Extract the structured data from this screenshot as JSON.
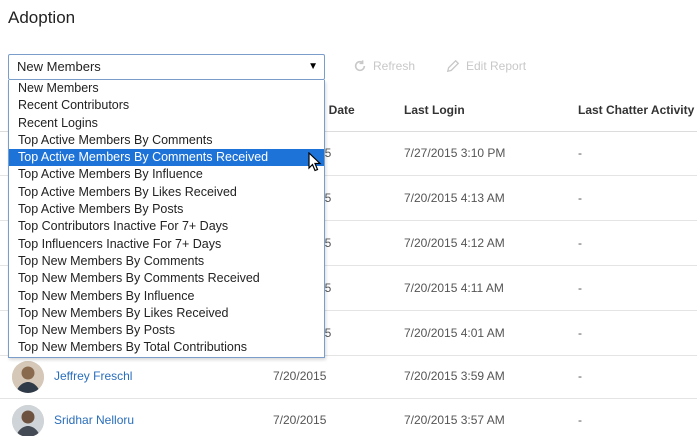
{
  "page": {
    "title": "Adoption"
  },
  "toolbar": {
    "selected_report": "New Members",
    "refresh_label": "Refresh",
    "edit_report_label": "Edit Report"
  },
  "dropdown": {
    "options": [
      "New Members",
      "Recent Contributors",
      "Recent Logins",
      "Top Active Members By Comments",
      "Top Active Members By Comments Received",
      "Top Active Members By Influence",
      "Top Active Members By Likes Received",
      "Top Active Members By Posts",
      "Top Contributors Inactive For 7+ Days",
      "Top Influencers Inactive For 7+ Days",
      "Top New Members By Comments",
      "Top New Members By Comments Received",
      "Top New Members By Influence",
      "Top New Members By Likes Received",
      "Top New Members By Posts",
      "Top New Members By Total Contributions"
    ],
    "highlighted_index": 4
  },
  "table": {
    "headers": {
      "created_date": "d Date",
      "last_login": "Last Login",
      "last_chatter_activity": "Last Chatter Activity"
    },
    "rows": [
      {
        "name": "",
        "created": "15",
        "last_login": "7/27/2015 3:10 PM",
        "last_activity": "-"
      },
      {
        "name": "",
        "created": "15",
        "last_login": "7/20/2015 4:13 AM",
        "last_activity": "-"
      },
      {
        "name": "",
        "created": "15",
        "last_login": "7/20/2015 4:12 AM",
        "last_activity": "-"
      },
      {
        "name": "",
        "created": "15",
        "last_login": "7/20/2015 4:11 AM",
        "last_activity": "-"
      },
      {
        "name": "",
        "created": "15",
        "last_login": "7/20/2015 4:01 AM",
        "last_activity": "-"
      },
      {
        "name": "Jeffrey Freschl",
        "created": "7/20/2015",
        "last_login": "7/20/2015 3:59 AM",
        "last_activity": "-"
      },
      {
        "name": "Sridhar Nelloru",
        "created": "7/20/2015",
        "last_login": "7/20/2015 3:57 AM",
        "last_activity": "-"
      }
    ]
  }
}
